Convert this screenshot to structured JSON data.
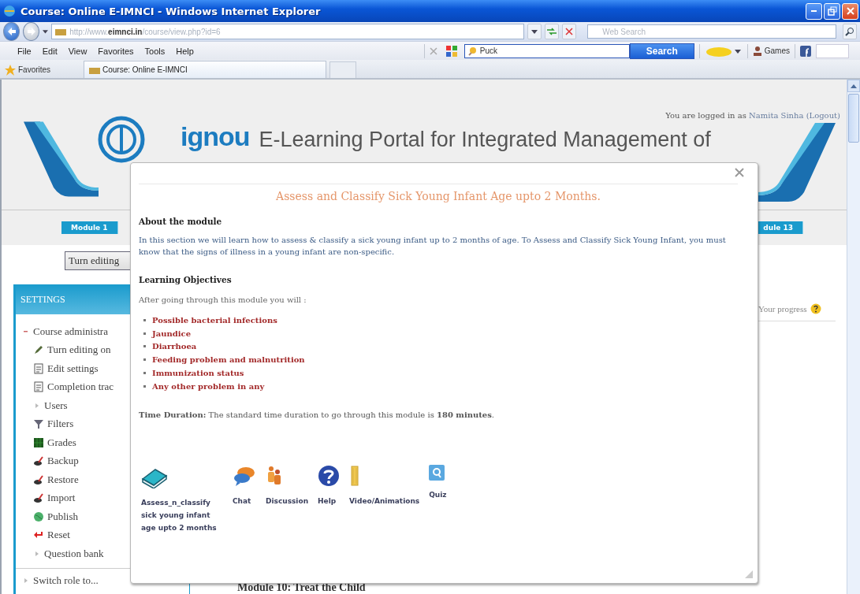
{
  "window": {
    "title": "Course: Online E-IMNCI - Windows Internet Explorer"
  },
  "address_bar": {
    "url": "http://www.**eimnci.in**/course/view.php?id=6",
    "search_placeholder": "Web Search"
  },
  "menu": [
    "File",
    "Edit",
    "View",
    "Favorites",
    "Tools",
    "Help"
  ],
  "toolbar": {
    "search_value": "Puck",
    "search_button": "Search",
    "games": "Games"
  },
  "favorites_bar": {
    "label": "Favorites",
    "tabs": [
      {
        "label": "Course: Online E-IMNCI",
        "selected": true
      }
    ]
  },
  "page": {
    "login": {
      "prefix": "You are logged in as",
      "user": "Namita Sinha",
      "logout": "(Logout)"
    },
    "logo_text": "ignou",
    "portal_title": "E-Learning Portal for Integrated Management of",
    "nav": [
      "Module 1",
      "dule 13"
    ],
    "edit_button": "Turn editing",
    "settings": {
      "title": "SETTINGS",
      "items": [
        {
          "label": "Course administra",
          "kind": "branch",
          "expanded": true,
          "children": [
            {
              "label": "Turn editing on",
              "kind": "edit"
            },
            {
              "label": "Edit settings",
              "kind": "doc"
            },
            {
              "label": "Completion trac",
              "kind": "doc"
            },
            {
              "label": "Users",
              "kind": "branch",
              "expanded": false
            },
            {
              "label": "Filters",
              "kind": "filter"
            },
            {
              "label": "Grades",
              "kind": "grades"
            },
            {
              "label": "Backup",
              "kind": "tool"
            },
            {
              "label": "Restore",
              "kind": "tool"
            },
            {
              "label": "Import",
              "kind": "tool"
            },
            {
              "label": "Publish",
              "kind": "publish"
            },
            {
              "label": "Reset",
              "kind": "reset"
            },
            {
              "label": "Question bank",
              "kind": "branch",
              "expanded": false
            }
          ]
        },
        {
          "label": "Switch role to...",
          "kind": "branch",
          "expanded": false
        }
      ]
    },
    "progress": "Your progress",
    "section_title": "Module 10: Treat the Child"
  },
  "modal": {
    "title": "Assess and Classify Sick Young Infant Age upto 2 Months.",
    "about_heading": "About the module",
    "about_text": "In this section we will learn how to assess & classify a sick young infant up to 2 months of age. To Assess and Classify Sick Young Infant, you must know that the signs of illness in a young infant are non-specific.",
    "objectives_heading": "Learning Objectives",
    "objectives_intro": "After going through this module you will :",
    "objectives": [
      "Possible bacterial infections",
      "Jaundice",
      "Diarrhoea",
      "Feeding problem and malnutrition",
      "Immunization status",
      "Any other problem in any"
    ],
    "duration": "**Time Duration:** The standard time duration to go through this module is **180 minutes**.",
    "activities": [
      {
        "kind": "book",
        "label": "Assess_n_classify sick young infant age upto 2 months"
      },
      {
        "kind": "chat",
        "label": "Chat"
      },
      {
        "kind": "forum",
        "label": "Discussion"
      },
      {
        "kind": "help",
        "label": "Help"
      },
      {
        "kind": "video",
        "label": "Video/Animations"
      },
      {
        "kind": "quiz",
        "label": "Quiz"
      }
    ]
  }
}
